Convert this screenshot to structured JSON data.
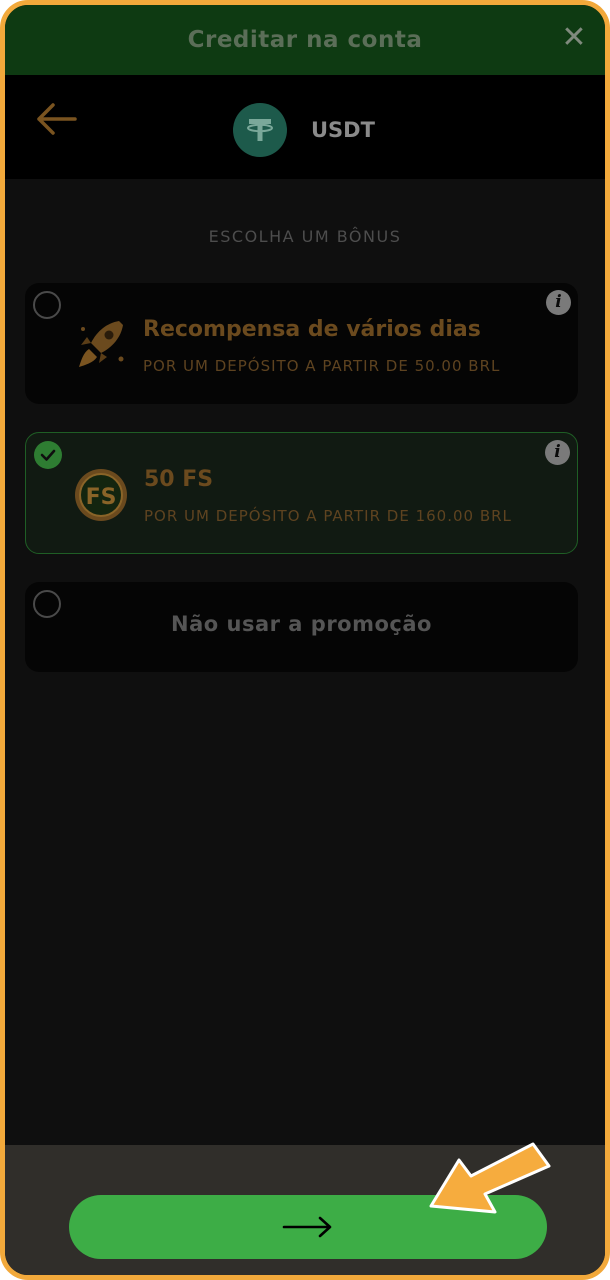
{
  "header": {
    "title": "Creditar na conta"
  },
  "currency": {
    "code": "USDT"
  },
  "bonus": {
    "section_label": "ESCOLHA UM BÔNUS",
    "options": [
      {
        "title": "Recompensa de vários dias",
        "subtitle": "POR UM DEPÓSITO A PARTIR DE 50.00 BRL",
        "selected": false,
        "icon": "rocket-icon"
      },
      {
        "title": "50 FS",
        "subtitle": "POR UM DEPÓSITO A PARTIR DE 160.00 BRL",
        "selected": true,
        "icon": "fs-coin-icon",
        "icon_text": "FS"
      },
      {
        "title": "Não usar a promoção",
        "selected": false
      }
    ]
  },
  "footer": {
    "next_label": "⟶"
  },
  "colors": {
    "accent": "#3dad46",
    "frame": "#f2a93b",
    "header": "#0e3a12",
    "bonus_text": "#6b4a1e"
  }
}
